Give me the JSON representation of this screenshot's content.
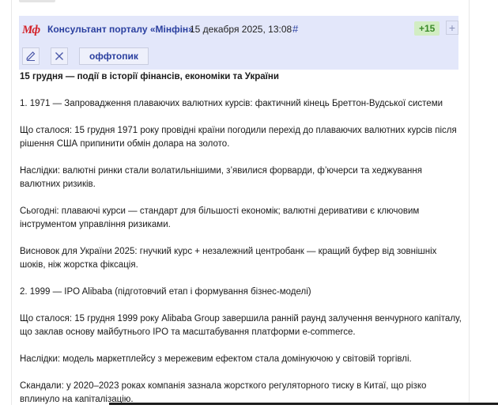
{
  "post": {
    "logo_text": "Мф",
    "author": "Консультант порталу «Мінфін»",
    "datetime": "15 декабря 2025, 13:08",
    "hash": "#",
    "score": "+15",
    "plus": "+",
    "tag": "оффтопик"
  },
  "content": {
    "title": "15 грудня — події в історії фінансів, економіки та України",
    "paragraphs": [
      "1. 1971 — Запровадження плаваючих валютних курсів: фактичний кінець Бреттон-Вудської системи",
      "Що сталося: 15 грудня 1971 року провідні країни погодили перехід до плаваючих валютних курсів після рішення США припинити обмін долара на золото.",
      "Наслідки: валютні ринки стали волатильнішими, з’явилися форварди, ф’ючерси та хеджування валютних ризиків.",
      "Сьогодні: плаваючі курси — стандарт для більшості економік; валютні деривативи є ключовим інструментом управління ризиками.",
      "Висновок для України 2025: гнучкий курс + незалежний центробанк — кращий буфер від зовнішніх шоків, ніж жорстка фіксація.",
      "2. 1999 — IPO Alibaba (підготовчий етап і формування бізнес-моделі)",
      "Що сталося: 15 грудня 1999 року Alibaba Group завершила ранній раунд залучення венчурного капіталу, що заклав основу майбутнього IPO та масштабування платформи e-commerce.",
      "Наслідки: модель маркетплейсу з мережевим ефектом стала домінуючою у світовій торгівлі.",
      "Скандали: у 2020–2023 роках компанія зазнала жорсткого регуляторного тиску в Китаї, що різко вплинуло на капіталізацію."
    ]
  },
  "colors": {
    "header_bg": "#e3e7fa",
    "author_link": "#2a3f9f",
    "score_bg": "#d2edc3",
    "logo": "#d32027"
  },
  "icons": [
    "pencil-icon",
    "close-icon"
  ]
}
